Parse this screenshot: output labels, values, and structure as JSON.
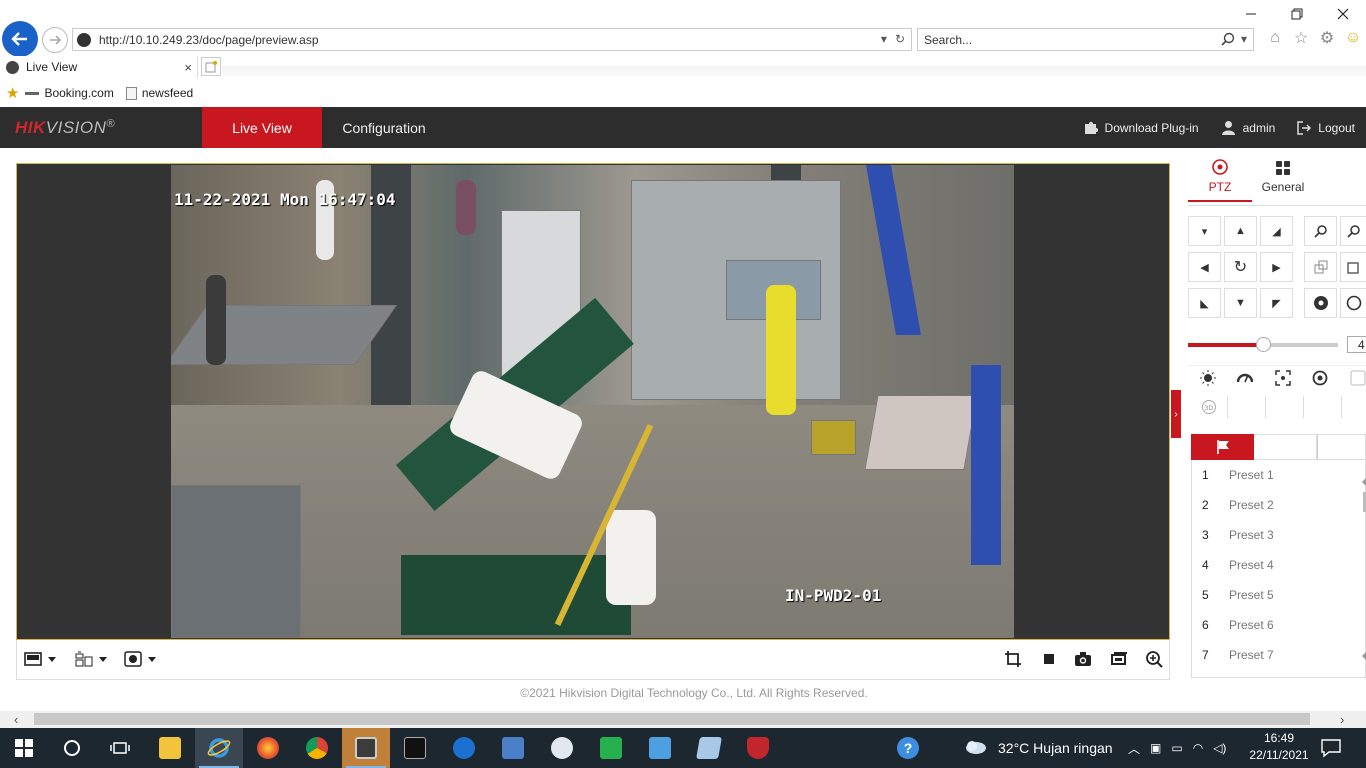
{
  "browser": {
    "url": "http://10.10.249.23/doc/page/preview.asp",
    "search_placeholder": "Search...",
    "tab_title": "Live View",
    "favorites": [
      {
        "label": "Booking.com"
      },
      {
        "label": "newsfeed"
      }
    ]
  },
  "header": {
    "logo_hik": "HIK",
    "logo_vision": "VISION",
    "logo_mark": "®",
    "nav_live": "Live View",
    "nav_config": "Configuration",
    "download_plugin": "Download Plug-in",
    "user": "admin",
    "logout": "Logout"
  },
  "video": {
    "osd_time": "11-22-2021 Mon 16:47:04",
    "osd_camera": "IN-PWD2-01"
  },
  "footer": {
    "copyright": "©2021 Hikvision Digital Technology Co., Ltd. All Rights Reserved."
  },
  "ptz": {
    "tab_ptz": "PTZ",
    "tab_general": "General",
    "speed": 4,
    "speed_label": "4",
    "speed_max": 7,
    "presets": [
      {
        "num": "1",
        "name": "Preset 1"
      },
      {
        "num": "2",
        "name": "Preset 2"
      },
      {
        "num": "3",
        "name": "Preset 3"
      },
      {
        "num": "4",
        "name": "Preset 4"
      },
      {
        "num": "5",
        "name": "Preset 5"
      },
      {
        "num": "6",
        "name": "Preset 6"
      },
      {
        "num": "7",
        "name": "Preset 7"
      }
    ]
  },
  "taskbar": {
    "weather": "32°C  Hujan ringan",
    "time": "16:49",
    "date": "22/11/2021"
  },
  "colors": {
    "brand_red": "#c8171e",
    "header_bg": "#2d2d2d",
    "taskbar_bg": "#1c2730"
  }
}
